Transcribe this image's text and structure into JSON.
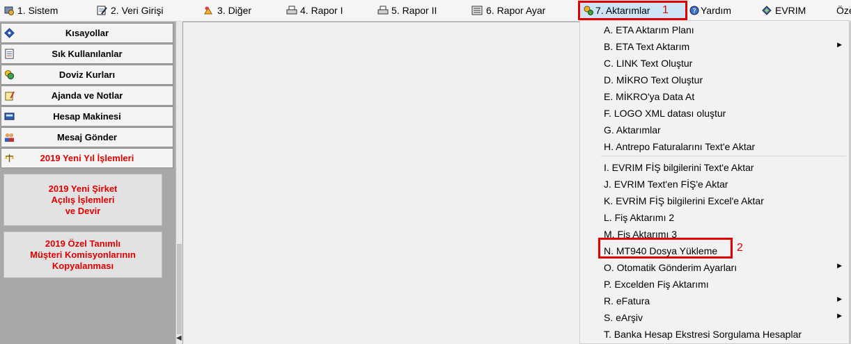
{
  "menubar": {
    "items": [
      {
        "label": "1.  Sistem"
      },
      {
        "label": "2.  Veri Girişi"
      },
      {
        "label": "3.  Diğer"
      },
      {
        "label": "4.   Rapor I"
      },
      {
        "label": "5.   Rapor II"
      },
      {
        "label": "6.   Rapor Ayar"
      },
      {
        "label": "7.  Aktarımlar"
      },
      {
        "label": "Yardım"
      },
      {
        "label": "EVRIM"
      },
      {
        "label": "Öze"
      }
    ],
    "highlight_color": "#cde4f7"
  },
  "annotations": {
    "box1_number": "1",
    "box2_number": "2",
    "color": "#e00000"
  },
  "leftpanel": {
    "buttons": [
      {
        "label": "Kısayollar",
        "icon": "diamond-icon"
      },
      {
        "label": "Sık Kullanılanlar",
        "icon": "checklist-icon"
      },
      {
        "label": "Doviz Kurları",
        "icon": "currency-icon"
      },
      {
        "label": "Ajanda ve Notlar",
        "icon": "notepad-icon"
      },
      {
        "label": "Hesap Makinesi",
        "icon": "calculator-icon"
      },
      {
        "label": "Mesaj Gönder",
        "icon": "people-icon"
      },
      {
        "label": "2019 Yeni Yıl İşlemleri",
        "icon": "scales-icon"
      }
    ],
    "big_buttons": [
      {
        "label": "2019 Yeni Şirket\nAçılış İşlemleri\nve Devir"
      },
      {
        "label": "2019 Özel Tanımlı\nMüşteri Komisyonlarının\nKopyalanması"
      }
    ]
  },
  "dropdown": {
    "items": [
      {
        "label": "A.   ETA Aktarım Planı",
        "submenu": false
      },
      {
        "label": "B.   ETA Text Aktarım",
        "submenu": true
      },
      {
        "label": "C.   LINK Text Oluştur",
        "submenu": false
      },
      {
        "label": "D.   MİKRO Text Oluştur",
        "submenu": false
      },
      {
        "label": "E.   MİKRO'ya  Data  At",
        "submenu": false
      },
      {
        "label": "F.   LOGO XML datası oluştur",
        "submenu": false
      },
      {
        "label": "G.   Aktarımlar",
        "submenu": false
      },
      {
        "label": "H.   Antrepo Faturalarını Text'e Aktar",
        "submenu": false
      },
      {
        "label": "I.    EVRIM FİŞ bilgilerini Text'e Aktar",
        "submenu": false
      },
      {
        "label": "J.    EVRIM Text'en FİŞ'e Aktar",
        "submenu": false
      },
      {
        "label": "K.    EVRİM FİŞ bilgilerini Excel'e Aktar",
        "submenu": false
      },
      {
        "label": "L.    Fiş Aktarımı 2",
        "submenu": false
      },
      {
        "label": "M.   Fiş Aktarımı 3",
        "submenu": false
      },
      {
        "label": "N.   MT940 Dosya Yükleme",
        "submenu": false
      },
      {
        "label": "O. Otomatik Gönderim Ayarları",
        "submenu": true
      },
      {
        "label": "P.   Excelden Fiş Aktarımı",
        "submenu": false
      },
      {
        "label": "R. eFatura",
        "submenu": true
      },
      {
        "label": "S.  eArşiv",
        "submenu": true
      },
      {
        "label": "T. Banka Hesap Ekstresi Sorgulama Hesaplar",
        "submenu": false
      }
    ]
  }
}
